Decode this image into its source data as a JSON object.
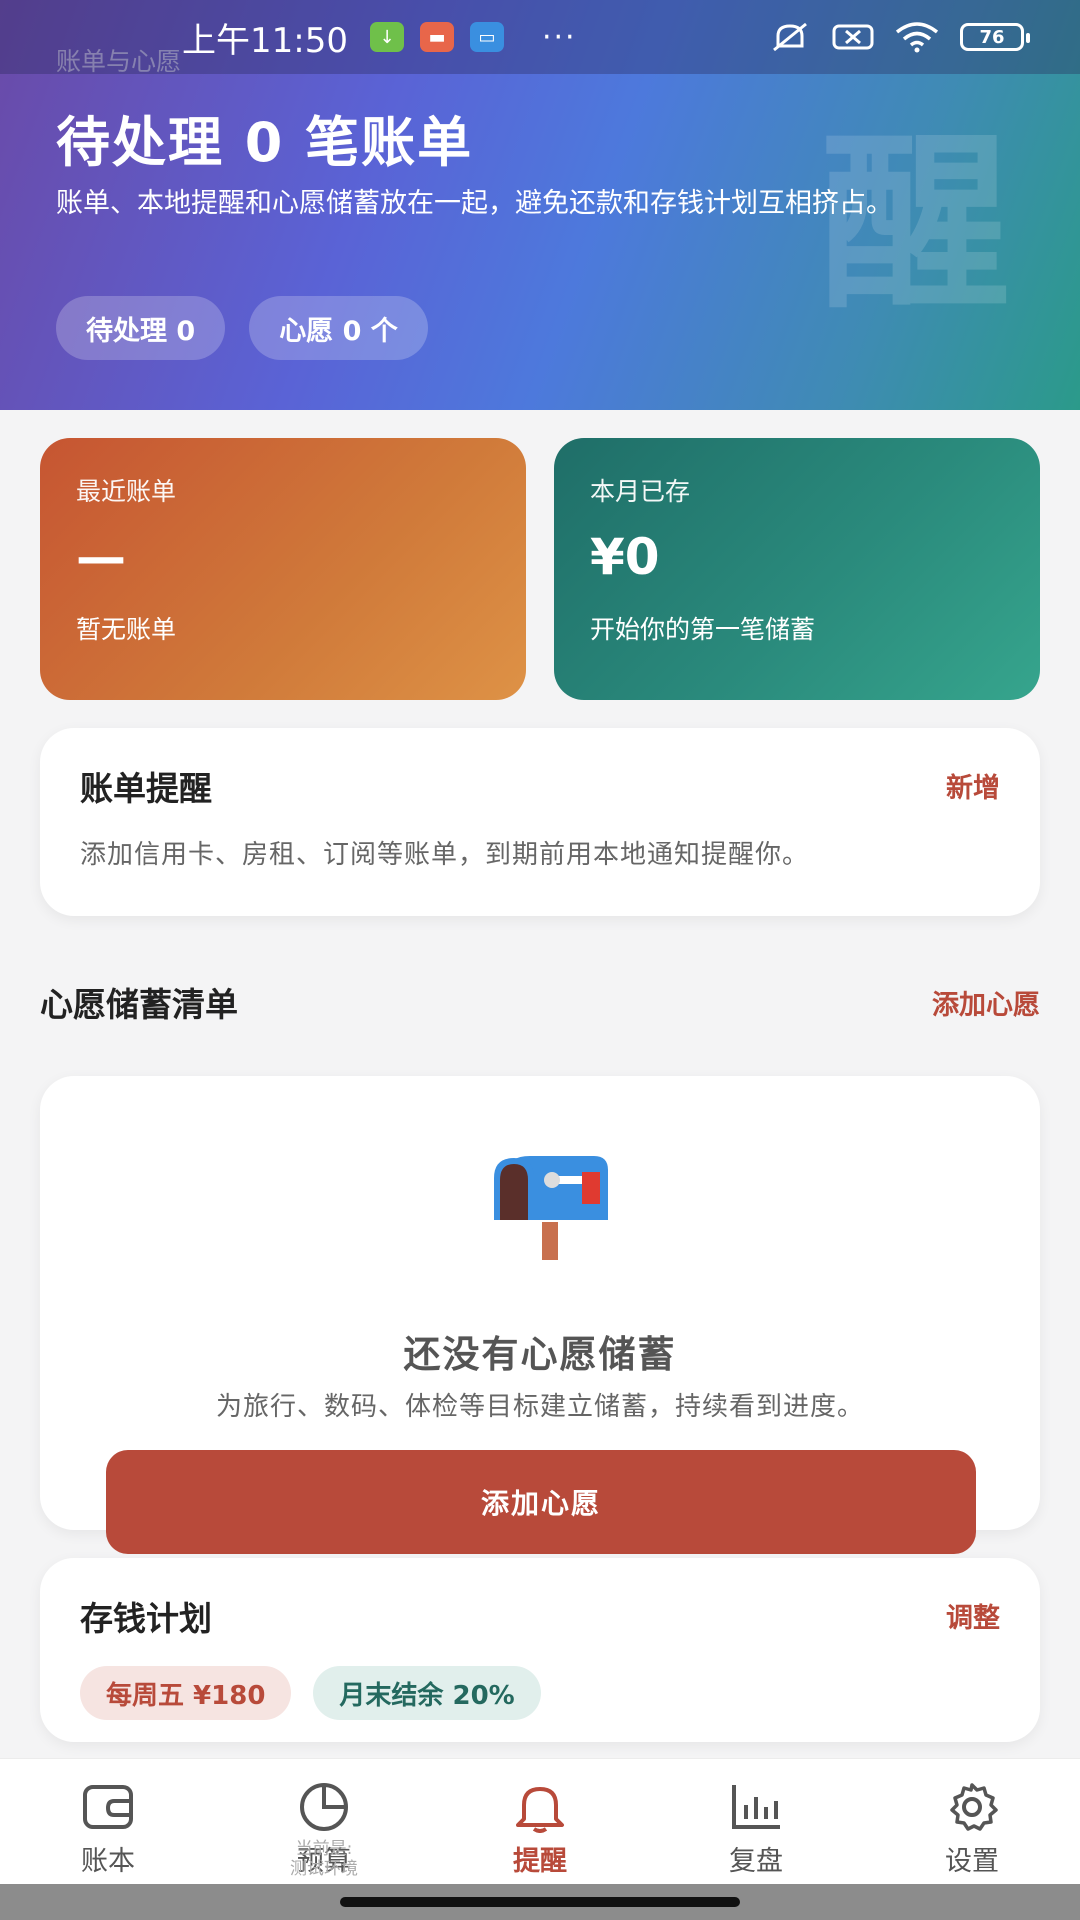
{
  "status_bar": {
    "time": "上午11:50",
    "dots": "···",
    "battery": "76"
  },
  "hero": {
    "subtitle": "账单与心愿",
    "title": "待处理 0 笔账单",
    "description": "账单、本地提醒和心愿储蓄放在一起，避免还款和存钱计划互相挤占。",
    "watermark": "醒",
    "pills": [
      "待处理 0",
      "心愿 0 个"
    ]
  },
  "summary": {
    "recent_bill": {
      "label": "最近账单",
      "value": "—",
      "caption": "暂无账单"
    },
    "saved_month": {
      "label": "本月已存",
      "value": "¥0",
      "caption": "开始你的第一笔储蓄"
    }
  },
  "bill_reminder": {
    "title": "账单提醒",
    "action": "新增",
    "text": "添加信用卡、房租、订阅等账单，到期前用本地通知提醒你。"
  },
  "wish_section": {
    "title": "心愿储蓄清单",
    "action": "添加心愿",
    "empty_title": "还没有心愿储蓄",
    "empty_text": "为旅行、数码、体检等目标建立储蓄，持续看到进度。",
    "button": "添加心愿"
  },
  "savings_plan": {
    "title": "存钱计划",
    "action": "调整",
    "chips": [
      "每周五 ¥180",
      "月末结余 20%"
    ]
  },
  "nav": {
    "items": [
      {
        "label": "账本",
        "icon": "wallet-icon"
      },
      {
        "label": "预算",
        "icon": "pie-chart-icon"
      },
      {
        "label": "提醒",
        "icon": "bell-icon"
      },
      {
        "label": "复盘",
        "icon": "bar-chart-icon"
      },
      {
        "label": "设置",
        "icon": "gear-icon"
      }
    ],
    "active_index": 2,
    "env_note_line1": "当前是:",
    "env_note_line2": "测试环境"
  },
  "colors": {
    "accent": "#b84a3a",
    "teal": "#24695f",
    "orange_card": "#d07a3a",
    "green_card": "#2a8a7c"
  }
}
